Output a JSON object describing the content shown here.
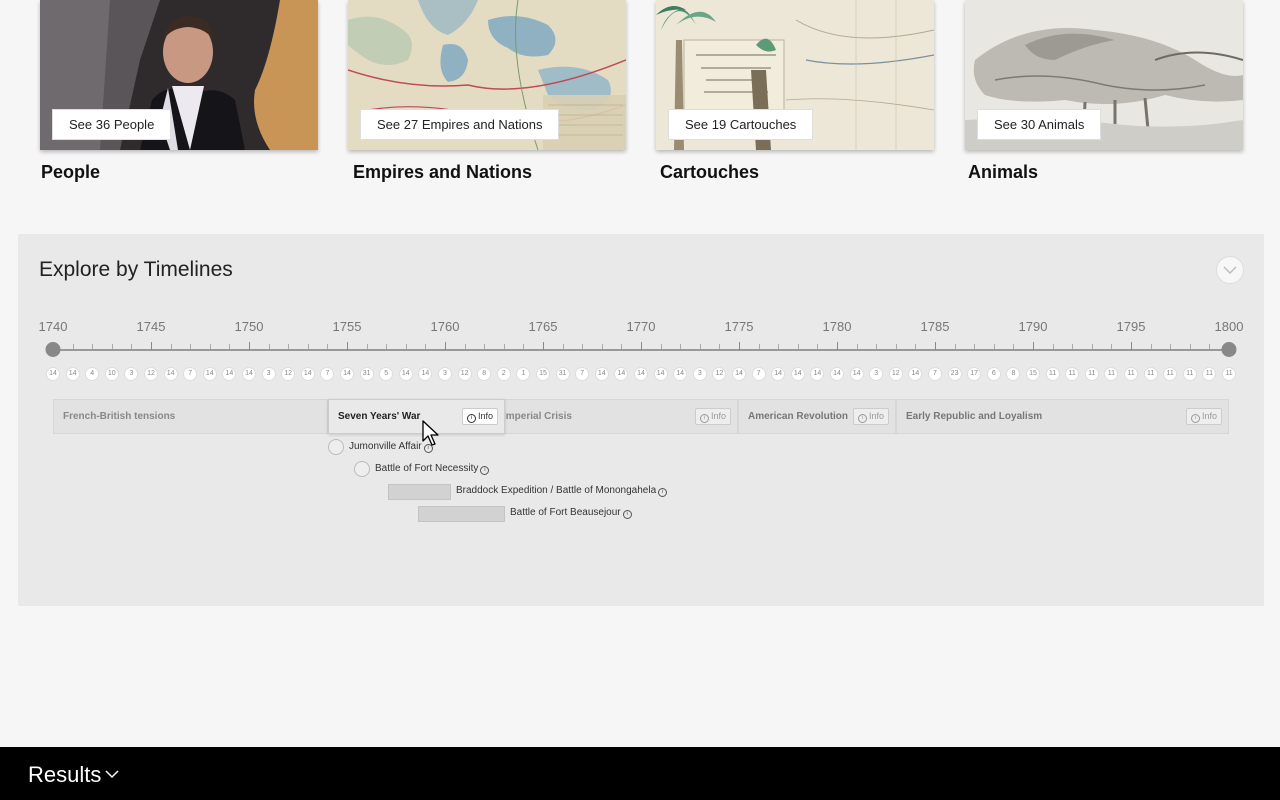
{
  "cards": [
    {
      "button_label": "See 36 People",
      "title": "People"
    },
    {
      "button_label": "See 27 Empires and Nations",
      "title": "Empires and Nations"
    },
    {
      "button_label": "See 19 Cartouches",
      "title": "Cartouches"
    },
    {
      "button_label": "See 30 Animals",
      "title": "Animals"
    }
  ],
  "timeline": {
    "title": "Explore by Timelines",
    "years": [
      "1740",
      "1745",
      "1750",
      "1755",
      "1760",
      "1765",
      "1770",
      "1775",
      "1780",
      "1785",
      "1790",
      "1795",
      "1800"
    ],
    "counts": [
      "14",
      "14",
      "4",
      "10",
      "3",
      "12",
      "14",
      "7",
      "14",
      "14",
      "14",
      "3",
      "12",
      "14",
      "7",
      "14",
      "31",
      "5",
      "14",
      "14",
      "3",
      "12",
      "8",
      "2",
      "1",
      "15",
      "31",
      "7",
      "14",
      "14",
      "14",
      "14",
      "14",
      "3",
      "12",
      "14",
      "7",
      "14",
      "14",
      "14",
      "14",
      "14",
      "3",
      "12",
      "14",
      "7",
      "23",
      "17",
      "6",
      "8",
      "15",
      "11",
      "11",
      "11",
      "11",
      "11",
      "11",
      "11",
      "11",
      "11",
      "11"
    ],
    "info_label": "Info",
    "periods": [
      {
        "label": "French-British tensions"
      },
      {
        "label": "Seven Years' War"
      },
      {
        "label": "Imperial Crisis"
      },
      {
        "label": "American Revolution"
      },
      {
        "label": "Early Republic and Loyalism"
      }
    ],
    "events": [
      {
        "label": "Jumonville Affair"
      },
      {
        "label": "Battle of Fort Necessity"
      },
      {
        "label": "Braddock Expedition / Battle of Monongahela"
      },
      {
        "label": "Battle of Fort Beausejour"
      }
    ]
  },
  "results": {
    "label": "Results"
  }
}
